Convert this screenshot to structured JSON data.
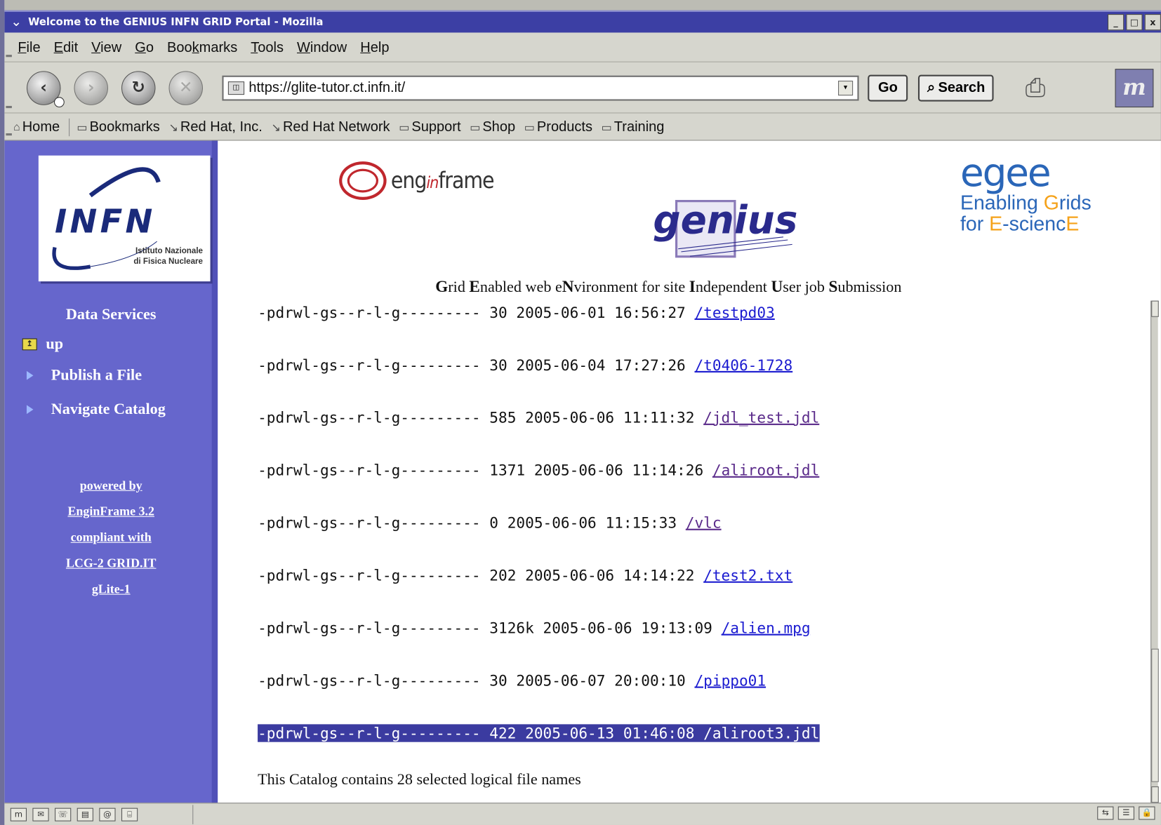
{
  "window": {
    "title": "Welcome to the GENIUS INFN GRID Portal - Mozilla",
    "controls": [
      "_",
      "□",
      "x"
    ]
  },
  "menubar": {
    "items": [
      {
        "pre": "",
        "key": "F",
        "post": "ile"
      },
      {
        "pre": "",
        "key": "E",
        "post": "dit"
      },
      {
        "pre": "",
        "key": "V",
        "post": "iew"
      },
      {
        "pre": "",
        "key": "G",
        "post": "o"
      },
      {
        "pre": "Boo",
        "key": "k",
        "post": "marks"
      },
      {
        "pre": "",
        "key": "T",
        "post": "ools"
      },
      {
        "pre": "",
        "key": "W",
        "post": "indow"
      },
      {
        "pre": "",
        "key": "H",
        "post": "elp"
      }
    ]
  },
  "navbar": {
    "back_icon": "back-icon",
    "forward_icon": "forward-icon",
    "reload_icon": "reload-icon",
    "stop_icon": "stop-icon",
    "url": "https://glite-tutor.ct.infn.it/",
    "go_label": "Go",
    "search_label": "Search"
  },
  "bookmarks": {
    "items": [
      "Home",
      "Bookmarks",
      "Red Hat, Inc.",
      "Red Hat Network",
      "Support",
      "Shop",
      "Products",
      "Training"
    ]
  },
  "sidebar": {
    "logo_text": "INFN",
    "logo_sub_1": "Istituto Nazionale",
    "logo_sub_2": "di Fisica Nucleare",
    "heading": "Data Services",
    "links": [
      "up",
      "Publish a File",
      "Navigate Catalog"
    ],
    "powered": [
      "powered by",
      "EnginFrame 3.2",
      "compliant with",
      "LCG-2 GRID.IT",
      "gLite-1"
    ]
  },
  "header": {
    "enginframe_pre": "eng",
    "enginframe_mid": "in",
    "enginframe_post": "frame",
    "genius_logo": "genius",
    "egee_logo": "egee",
    "egee_line1_a": "Enabling ",
    "egee_line1_b": "G",
    "egee_line1_c": "rids",
    "egee_line2_a": "for ",
    "egee_line2_b": "E",
    "egee_line2_c": "-scienc",
    "egee_line2_d": "E"
  },
  "tagline": {
    "parts": [
      "G",
      "rid ",
      "E",
      "nabled web e",
      "N",
      "vironment for site ",
      "I",
      "ndependent ",
      "U",
      "ser job ",
      "S",
      "ubmission"
    ]
  },
  "files": [
    {
      "perm": "-pdrwl-gs--r-l-g---------",
      "size": "30",
      "date": "2005-06-01",
      "time": "16:56:27",
      "name": "/testpd03",
      "visited": false,
      "selected": false
    },
    {
      "perm": "-pdrwl-gs--r-l-g---------",
      "size": "30",
      "date": "2005-06-04",
      "time": "17:27:26",
      "name": "/t0406-1728",
      "visited": false,
      "selected": false
    },
    {
      "perm": "-pdrwl-gs--r-l-g---------",
      "size": "585",
      "date": "2005-06-06",
      "time": "11:11:32",
      "name": "/jdl_test.jdl",
      "visited": true,
      "selected": false
    },
    {
      "perm": "-pdrwl-gs--r-l-g---------",
      "size": "1371",
      "date": "2005-06-06",
      "time": "11:14:26",
      "name": "/aliroot.jdl",
      "visited": true,
      "selected": false
    },
    {
      "perm": "-pdrwl-gs--r-l-g---------",
      "size": "0",
      "date": "2005-06-06",
      "time": "11:15:33",
      "name": "/vlc",
      "visited": true,
      "selected": false
    },
    {
      "perm": "-pdrwl-gs--r-l-g---------",
      "size": "202",
      "date": "2005-06-06",
      "time": "14:14:22",
      "name": "/test2.txt",
      "visited": false,
      "selected": false
    },
    {
      "perm": "-pdrwl-gs--r-l-g---------",
      "size": "3126k",
      "date": "2005-06-06",
      "time": "19:13:09",
      "name": "/alien.mpg",
      "visited": false,
      "selected": false
    },
    {
      "perm": "-pdrwl-gs--r-l-g---------",
      "size": "30",
      "date": "2005-06-07",
      "time": "20:00:10",
      "name": "/pippo01",
      "visited": false,
      "selected": false
    },
    {
      "perm": "-pdrwl-gs--r-l-g---------",
      "size": "422",
      "date": "2005-06-13",
      "time": "01:46:08",
      "name": "/aliroot3.jdl",
      "visited": false,
      "selected": true
    }
  ],
  "catalog_note": "This Catalog contains 28 selected logical file names",
  "statusbar": {
    "left_icons": [
      "mozilla-icon",
      "mail-icon",
      "chat-icon",
      "composer-icon",
      "addressbook-icon",
      "irc-icon"
    ],
    "right_icons": [
      "online-icon",
      "security-icon",
      "lock-icon"
    ]
  }
}
